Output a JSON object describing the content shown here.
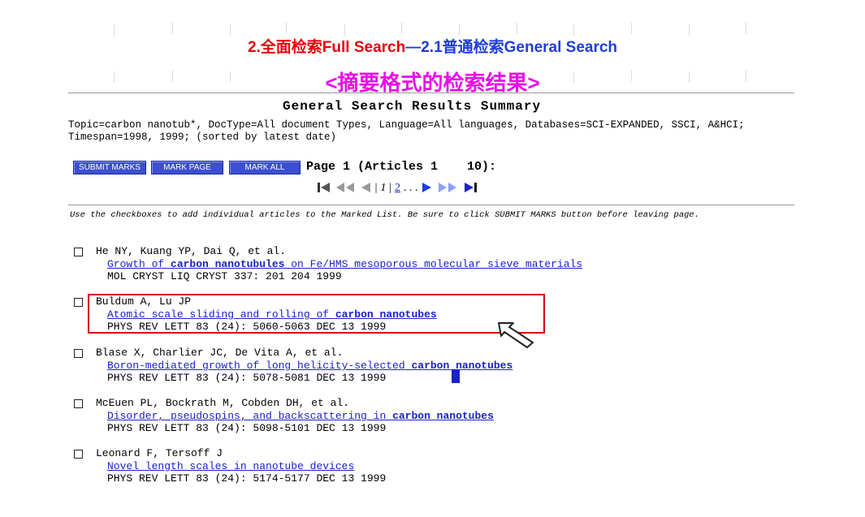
{
  "slide": {
    "title_part1": "2.全面检索Full Search",
    "title_part2": "—2.1普通检索General Search",
    "subtitle": "<摘要格式的检索结果>"
  },
  "results": {
    "heading": "General Search Results  Summary",
    "query": "Topic=carbon nanotub*, DocType=All document Types, Language=All languages, Databases=SCI-EXPANDED, SSCI, A&HCI; Timespan=1998, 1999; (sorted by latest date)",
    "buttons": {
      "submit": "SUBMIT MARKS",
      "mark_page": "MARK PAGE",
      "mark_all": "MARK ALL"
    },
    "page_info": "Page 1 (Articles 1    10):",
    "pager": {
      "current": "1",
      "next": "2",
      "ellipsis": ". . ."
    },
    "instructions": "Use the checkboxes to add individual articles to the Marked List. Be sure to click SUBMIT MARKS button before leaving page.",
    "records": [
      {
        "authors": "He NY, Kuang YP, Dai Q, et al.",
        "title_pre": "Growth of ",
        "title_bold": "carbon nanotubules",
        "title_post": " on Fe/HMS mesoporous molecular sieve materials",
        "source": "MOL CRYST LIQ CRYST 337: 201 204 1999"
      },
      {
        "authors": "Buldum A, Lu JP",
        "title_pre": "Atomic scale sliding and rolling of ",
        "title_bold": "carbon nanotubes",
        "title_post": "",
        "source": "PHYS REV LETT 83 (24): 5060-5063 DEC 13 1999"
      },
      {
        "authors": "Blase X, Charlier JC, De Vita A, et al.",
        "title_pre": "Boron-mediated growth of long helicity-selected ",
        "title_bold": "carbon nanotubes",
        "title_post": "",
        "source": "PHYS REV LETT 83 (24): 5078-5081 DEC 13 1999"
      },
      {
        "authors": "McEuen PL, Bockrath M, Cobden DH, et al.",
        "title_pre": "Disorder, pseudospins, and backscattering in ",
        "title_bold": "carbon nanotubes",
        "title_post": "",
        "source": "PHYS REV LETT 83 (24): 5098-5101 DEC 13 1999"
      },
      {
        "authors": "Leonard F, Tersoff J",
        "title_pre": "Novel length scales in nanotube devices",
        "title_bold": "",
        "title_post": "",
        "source": "PHYS REV LETT 83 (24): 5174-5177 DEC 13 1999"
      }
    ]
  },
  "icons": [
    "first-page-icon",
    "prev-group-icon",
    "prev-page-icon",
    "next-page-icon",
    "next-group-icon",
    "last-page-icon",
    "pointer-arrow-icon"
  ],
  "colors": {
    "title_red": "#e8000b",
    "title_blue": "#1f3ddb",
    "subtitle_magenta": "#e80ee8",
    "button_blue": "#3c4fd0",
    "link_blue": "#1a22c8",
    "highlight_red": "#d40000"
  }
}
